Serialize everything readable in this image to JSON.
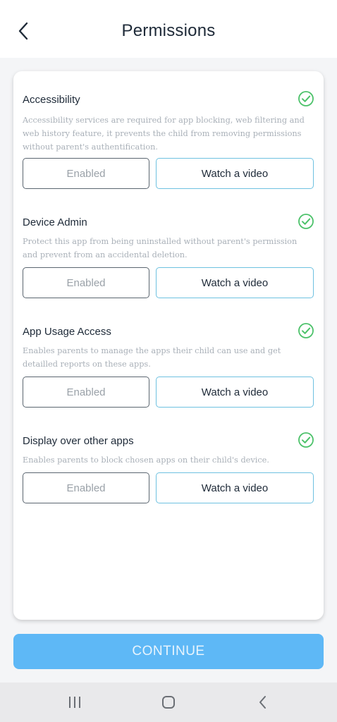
{
  "header": {
    "title": "Permissions",
    "back_icon": "chevron-left-icon"
  },
  "permissions": [
    {
      "title": "Accessibility",
      "description": "Accessibility services are required for app blocking, web filtering and web history feature, it prevents the child from removing permissions  without parent's authentification.",
      "status_icon": "check-circle-icon",
      "enabled_label": "Enabled",
      "video_label": "Watch a video"
    },
    {
      "title": "Device Admin",
      "description": "Protect this app from being uninstalled without parent's permission and prevent from an accidental deletion.",
      "status_icon": "check-circle-icon",
      "enabled_label": "Enabled",
      "video_label": "Watch a video"
    },
    {
      "title": "App Usage Access",
      "description": "Enables parents to manage the apps their child can use and get detailled reports on these apps.",
      "status_icon": "check-circle-icon",
      "enabled_label": "Enabled",
      "video_label": "Watch a video"
    },
    {
      "title": "Display over other apps",
      "description": "Enables parents to block chosen apps on their child's device.",
      "status_icon": "check-circle-icon",
      "enabled_label": "Enabled",
      "video_label": "Watch a video"
    }
  ],
  "footer": {
    "continue_label": "CONTINUE"
  },
  "navbar": {
    "icons": [
      "recent-apps-icon",
      "home-icon",
      "back-icon"
    ]
  },
  "colors": {
    "accent": "#5eb8f6",
    "check": "#4cc26a",
    "video_border": "#6ec1e0"
  }
}
